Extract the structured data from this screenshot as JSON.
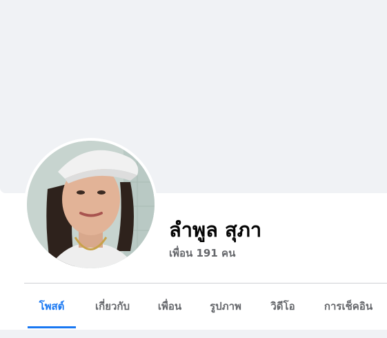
{
  "profile": {
    "name": "ลำพูล สุภา",
    "friends_text": "เพื่อน 191 คน"
  },
  "tabs": [
    {
      "label": "โพสต์",
      "active": true
    },
    {
      "label": "เกี่ยวกับ",
      "active": false
    },
    {
      "label": "เพื่อน",
      "active": false
    },
    {
      "label": "รูปภาพ",
      "active": false
    },
    {
      "label": "วิดีโอ",
      "active": false
    },
    {
      "label": "การเช็คอิน",
      "active": false
    }
  ],
  "colors": {
    "accent": "#1877f2",
    "cover": "#f0f2f5",
    "text_primary": "#050505",
    "text_secondary": "#65676b"
  }
}
